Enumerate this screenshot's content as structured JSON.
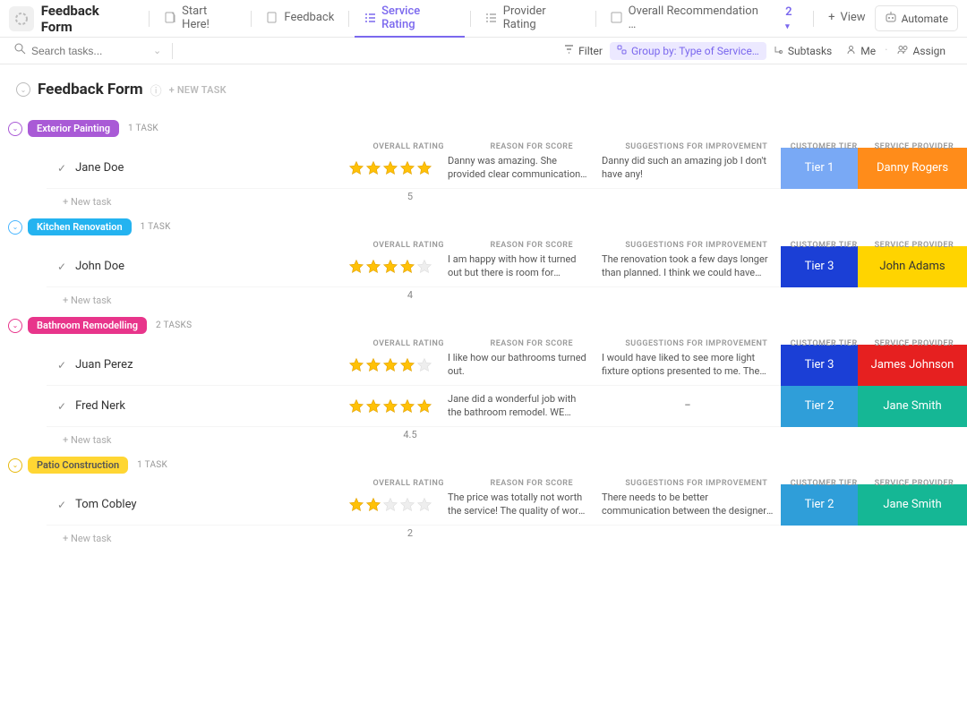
{
  "app": {
    "title": "Feedback Form"
  },
  "tabs": {
    "start": "Start Here!",
    "feedback": "Feedback",
    "service_rating": "Service Rating",
    "provider_rating": "Provider Rating",
    "overall": "Overall Recommendation …",
    "more_count": "2",
    "view": "View"
  },
  "topright": {
    "automate": "Automate"
  },
  "toolbar": {
    "search_placeholder": "Search tasks...",
    "filter": "Filter",
    "group_by": "Group by: Type of Service…",
    "subtasks": "Subtasks",
    "me": "Me",
    "assign": "Assign"
  },
  "page": {
    "title": "Feedback Form",
    "new_task": "+ NEW TASK"
  },
  "columns": {
    "overall": "OVERALL RATING",
    "reason": "REASON FOR SCORE",
    "suggestions": "SUGGESTIONS FOR IMPROVEMENT",
    "tier": "CUSTOMER TIER",
    "provider": "SERVICE PROVIDER"
  },
  "groups": [
    {
      "name": "Exterior Painting",
      "count": "1 TASK",
      "footer": "5",
      "tasks": [
        {
          "name": "Jane Doe",
          "stars": 5,
          "reason": "Danny was amazing. She provid­ed clear communication of time…",
          "suggest": "Danny did such an amazing job I don't have any!",
          "tier": "Tier 1",
          "provider": "Danny Rogers",
          "tier_class": "tier-t1",
          "prov_class": "prov-orange"
        }
      ]
    },
    {
      "name": "Kitchen Renovation",
      "count": "1 TASK",
      "footer": "4",
      "tasks": [
        {
          "name": "John Doe",
          "stars": 4,
          "reason": "I am happy with how it turned out but there is room for improvement",
          "suggest": "The renovation took a few days longer than planned. I think we could have finished on …",
          "tier": "Tier 3",
          "provider": "John Adams",
          "tier_class": "tier-t3",
          "prov_class": "prov-yellow"
        }
      ]
    },
    {
      "name": "Bathroom Remodelling",
      "count": "2 TASKS",
      "footer": "4.5",
      "tasks": [
        {
          "name": "Juan Perez",
          "stars": 4,
          "reason": "I like how our bathrooms turned out.",
          "suggest": "I would have liked to see more light fixture op­tions presented to me. The options provided…",
          "tier": "Tier 3",
          "provider": "James Johnson",
          "tier_class": "tier-t3",
          "prov_class": "prov-red"
        },
        {
          "name": "Fred Nerk",
          "stars": 5,
          "reason": "Jane did a wonderful job with the bathroom remodel. WE LOVE IT!",
          "suggest": "–",
          "tier": "Tier 2",
          "provider": "Jane Smith",
          "tier_class": "tier-t2",
          "prov_class": "prov-teal"
        }
      ]
    },
    {
      "name": "Patio Construction",
      "count": "1 TASK",
      "footer": "2",
      "tasks": [
        {
          "name": "Tom Cobley",
          "stars": 2,
          "reason": "The price was totally not worth the service! The quality of work …",
          "suggest": "There needs to be better communication be­tween the designer and the people doing the…",
          "tier": "Tier 2",
          "provider": "Jane Smith",
          "tier_class": "tier-t2",
          "prov_class": "prov-teal"
        }
      ]
    }
  ],
  "ui": {
    "new_task_row": "+ New task"
  }
}
